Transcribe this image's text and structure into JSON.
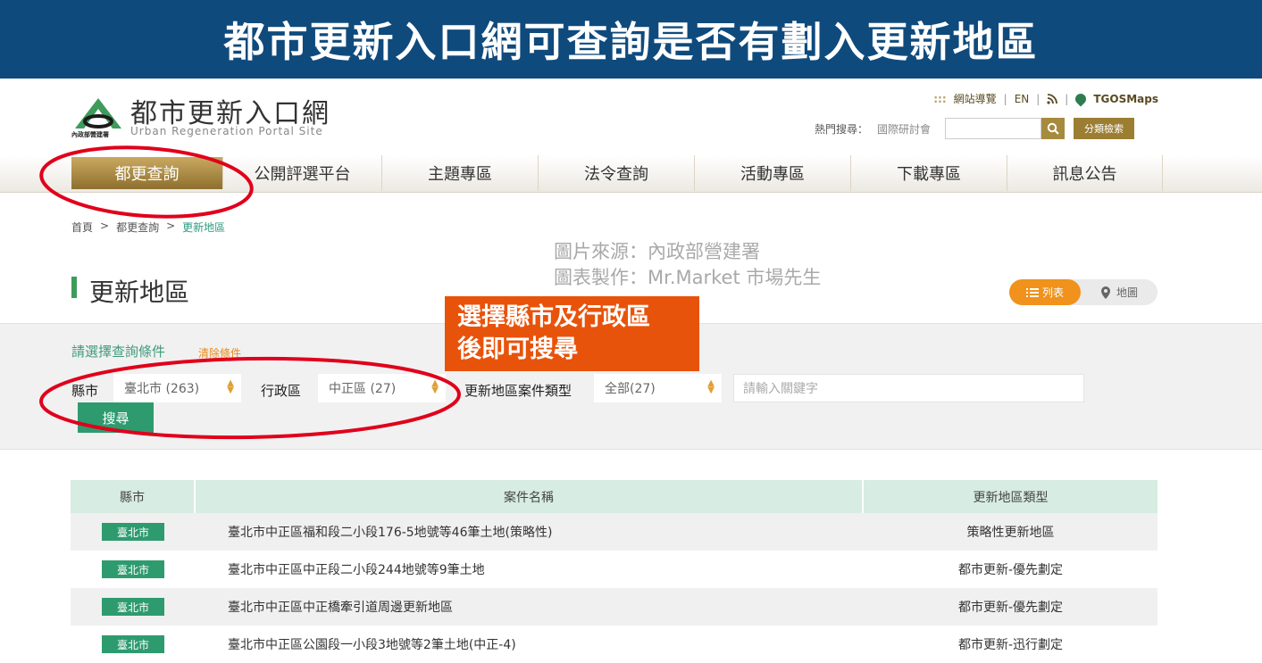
{
  "banner": {
    "title": "都市更新入口網可查詢是否有劃入更新地區"
  },
  "site": {
    "logo_zh": "都市更新入口網",
    "logo_en": "Urban Regeneration Portal Site",
    "logo_sub": "內政部營建署"
  },
  "topnav": {
    "sitemap": "網站導覽",
    "en": "EN",
    "tgos": "TGOSMaps",
    "dots": ":::"
  },
  "hot_search": {
    "label": "熱門搜尋：",
    "term": "國際研討會",
    "adv_button": "分類檢索"
  },
  "mainnav": [
    {
      "label": "都更查詢"
    },
    {
      "label": "公開評選平台"
    },
    {
      "label": "主題專區"
    },
    {
      "label": "法令查詢"
    },
    {
      "label": "活動專區"
    },
    {
      "label": "下載專區"
    },
    {
      "label": "訊息公告"
    }
  ],
  "breadcrumb": {
    "home": "首頁",
    "level1": "都更查詢",
    "current": "更新地區",
    "sep": ">"
  },
  "credit": {
    "line1": "圖片來源：內政部營建署",
    "line2": "圖表製作：Mr.Market 市場先生"
  },
  "page": {
    "title": "更新地區"
  },
  "view_toggle": {
    "list": "列表",
    "map": "地圖"
  },
  "callout": {
    "line1": "選擇縣市及行政區",
    "line2": "後即可搜尋"
  },
  "filter": {
    "title": "請選擇查詢條件",
    "clear": "清除條件",
    "city_label": "縣市",
    "city_value": "臺北市 (263)",
    "district_label": "行政區",
    "district_value": "中正區 (27)",
    "type_label": "更新地區案件類型",
    "type_value": "全部(27)",
    "keyword_placeholder": "請輸入關鍵字",
    "search_button": "搜尋"
  },
  "table": {
    "headers": [
      "縣市",
      "案件名稱",
      "更新地區類型"
    ],
    "rows": [
      {
        "city": "臺北市",
        "name": "臺北市中正區福和段二小段176-5地號等46筆土地(策略性)",
        "type": "策略性更新地區"
      },
      {
        "city": "臺北市",
        "name": "臺北市中正區中正段二小段244地號等9筆土地",
        "type": "都市更新-優先劃定"
      },
      {
        "city": "臺北市",
        "name": "臺北市中正區中正橋牽引道周邊更新地區",
        "type": "都市更新-優先劃定"
      },
      {
        "city": "臺北市",
        "name": "臺北市中正區公園段一小段3地號等2筆土地(中正-4)",
        "type": "都市更新-迅行劃定"
      }
    ]
  },
  "colors": {
    "banner": "#0f4a7c",
    "accent_gold": "#a68a3e",
    "accent_green": "#2e9b6f",
    "callout": "#e8530b",
    "annotation": "#e0001b"
  }
}
